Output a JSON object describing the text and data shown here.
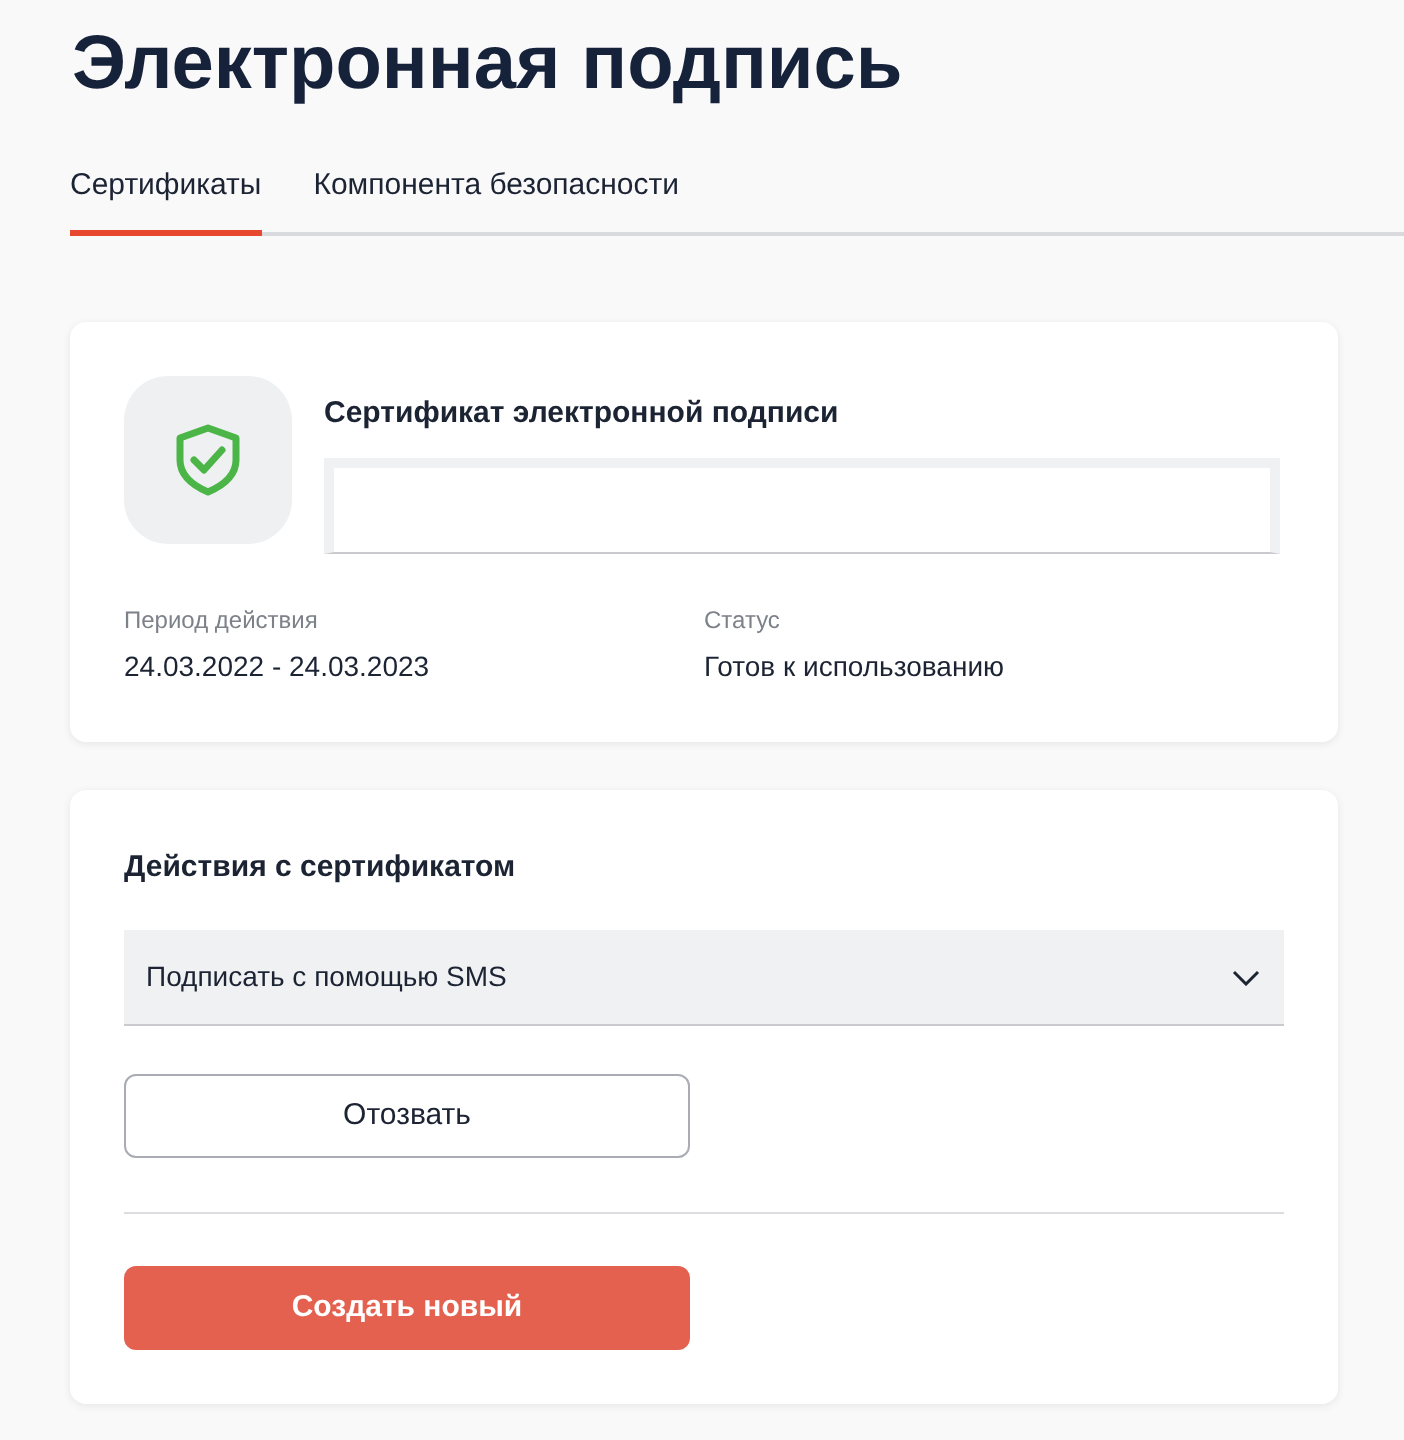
{
  "title": "Электронная подпись",
  "tabs": [
    {
      "label": "Сертификаты",
      "selected": true
    },
    {
      "label": "Компонента безопасности",
      "selected": false
    }
  ],
  "certificate": {
    "title": "Сертификат электронной подписи",
    "fields": [
      {
        "label": "Период действия",
        "value": "24.03.2022 - 24.03.2023"
      },
      {
        "label": "Статус",
        "value": "Готов к использованию"
      }
    ]
  },
  "actions": {
    "title": "Действия с сертификатом",
    "select_value": "Подписать с помощью SMS",
    "buttons": [
      {
        "label": "Отозвать",
        "kind": "outline"
      },
      {
        "label": "Создать новый",
        "kind": "primary"
      }
    ]
  }
}
